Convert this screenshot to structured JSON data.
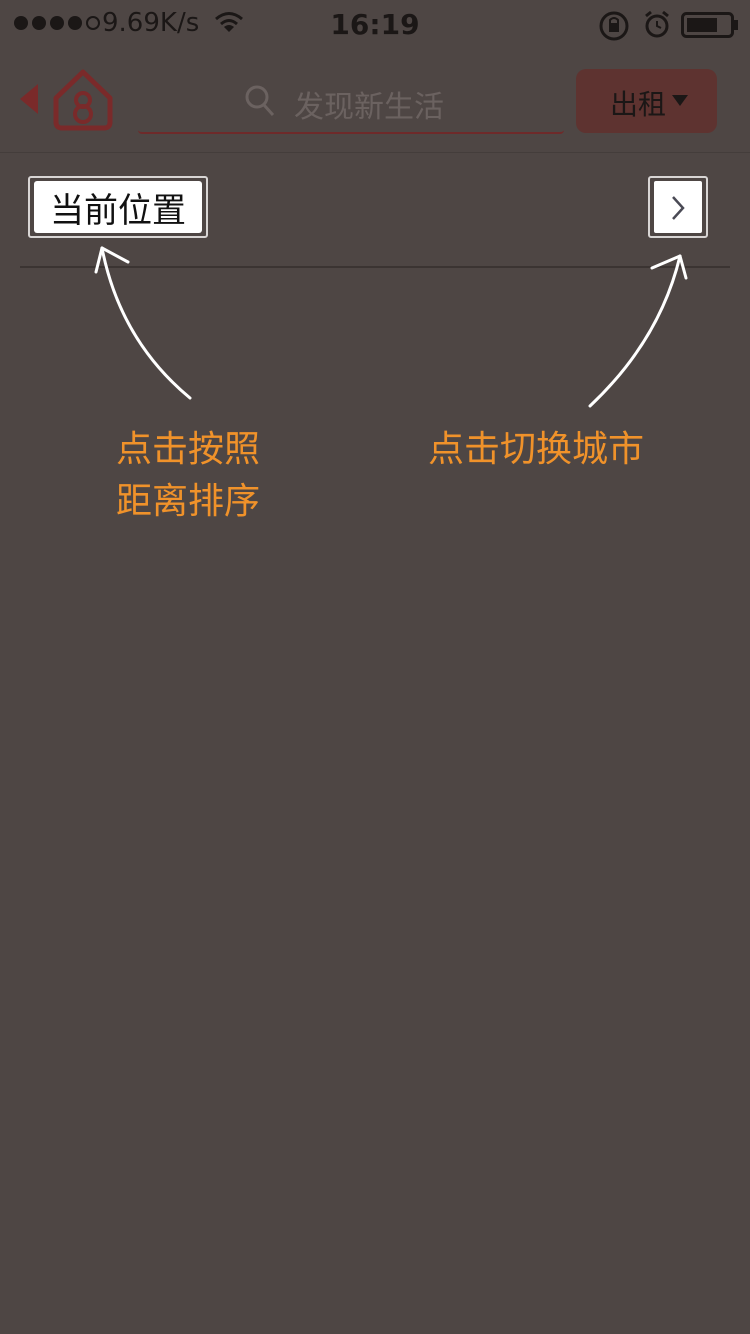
{
  "status_bar": {
    "network_speed": "9.69K/s",
    "time": "16:19"
  },
  "nav": {
    "search_placeholder": "发现新生活",
    "rent_button_label": "出租"
  },
  "location_row": {
    "current_location_label": "当前位置"
  },
  "hints": {
    "left_line1": "点击按照",
    "left_line2": "距离排序",
    "right": "点击切换城市"
  },
  "colors": {
    "overlay_background": "#4e4644",
    "hint_text": "#f0922a",
    "brand_red": "#6e2a2a"
  }
}
